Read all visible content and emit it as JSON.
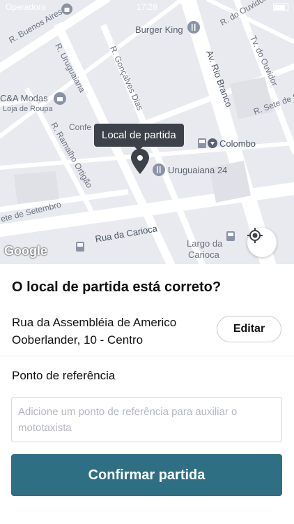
{
  "status_bar": {
    "carrier": "Operadora",
    "time": "17:28"
  },
  "map": {
    "streets": {
      "buenos_aires": "R. Buenos Aires",
      "uruguaiana": "R. Uruguaiana",
      "goncalves_dias": "R. Gonçalves Dias",
      "rio_branco": "Av. Rio Branco",
      "ouvidor_top": "R. do Ouvidor",
      "ouvidor_tv": "Tv. do Ouvidor",
      "sete_setembro_right": "R. Sete de Set",
      "ramalho_ortigao": "R. Ramalho Ortigão",
      "sete_setembro_left": "ete de Setembro",
      "carioca": "Rua da Carioca"
    },
    "places": {
      "burger_king": "Burger King",
      "ca_modas": "C&A Modas",
      "ca_modas_sub": "Loja de Roupa",
      "confeitaria": "Confe",
      "colombo": "Colombo",
      "uruguaiana_24": "Uruguaiana 24",
      "largo_line1": "Largo da",
      "largo_line2": "Carioca"
    },
    "tooltip": "Local de partida",
    "attribution": "Google"
  },
  "panel": {
    "question": "O local de partida está correto?",
    "address_line1": "Rua da Assembléia de Americo",
    "address_line2": "Ooberlander, 10 - Centro",
    "edit_label": "Editar",
    "reference_label": "Ponto de referência",
    "reference_placeholder": "Adicione um ponto de referência para auxiliar o mototaxista",
    "reference_value": "",
    "confirm_label": "Confirmar partida"
  },
  "colors": {
    "primary": "#2e6f84",
    "map_bg": "#e8eaef",
    "road": "#ffffff",
    "tooltip_bg": "#3d4149",
    "pin": "#3d4149"
  },
  "icons": [
    "location-pin-icon",
    "my-location-icon",
    "restaurant-icon",
    "shopping-bag-icon",
    "bus-stop-icon",
    "cafe-icon"
  ]
}
